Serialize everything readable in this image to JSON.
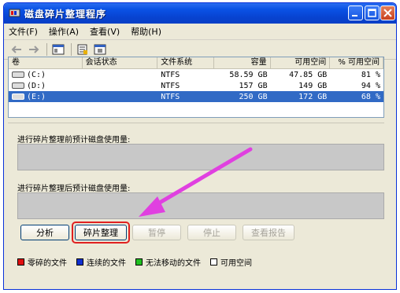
{
  "window": {
    "title": "磁盘碎片整理程序"
  },
  "menu": [
    "文件(F)",
    "操作(A)",
    "查看(V)",
    "帮助(H)"
  ],
  "columns": {
    "volume": "卷",
    "state": "会话状态",
    "fs": "文件系统",
    "capacity": "容量",
    "free": "可用空间",
    "pct": "% 可用空间"
  },
  "volumes": [
    {
      "volume": "(C:)",
      "state": "",
      "fs": "NTFS",
      "capacity": "58.59 GB",
      "free": "47.85 GB",
      "pct": "81 %"
    },
    {
      "volume": "(D:)",
      "state": "",
      "fs": "NTFS",
      "capacity": "157 GB",
      "free": "149 GB",
      "pct": "94 %"
    },
    {
      "volume": "(E:)",
      "state": "",
      "fs": "NTFS",
      "capacity": "250 GB",
      "free": "172 GB",
      "pct": "68 %"
    }
  ],
  "selected_volume_index": 2,
  "panel": {
    "before_label": "进行碎片整理前预计磁盘使用量:",
    "after_label": "进行碎片整理后预计磁盘使用量:"
  },
  "buttons": {
    "analyze": "分析",
    "defrag": "碎片整理",
    "pause": "暂停",
    "stop": "停止",
    "report": "查看报告"
  },
  "legend": [
    {
      "label": "零碎的文件",
      "color": "#e01010"
    },
    {
      "label": "连续的文件",
      "color": "#1030d0"
    },
    {
      "label": "无法移动的文件",
      "color": "#20c020"
    },
    {
      "label": "可用空间",
      "color": "#ffffff"
    }
  ],
  "colors": {
    "title_bar": "#0a52e5",
    "selection": "#316ac5",
    "highlight": "#e02020",
    "annotation_arrow": "#e040e0"
  }
}
